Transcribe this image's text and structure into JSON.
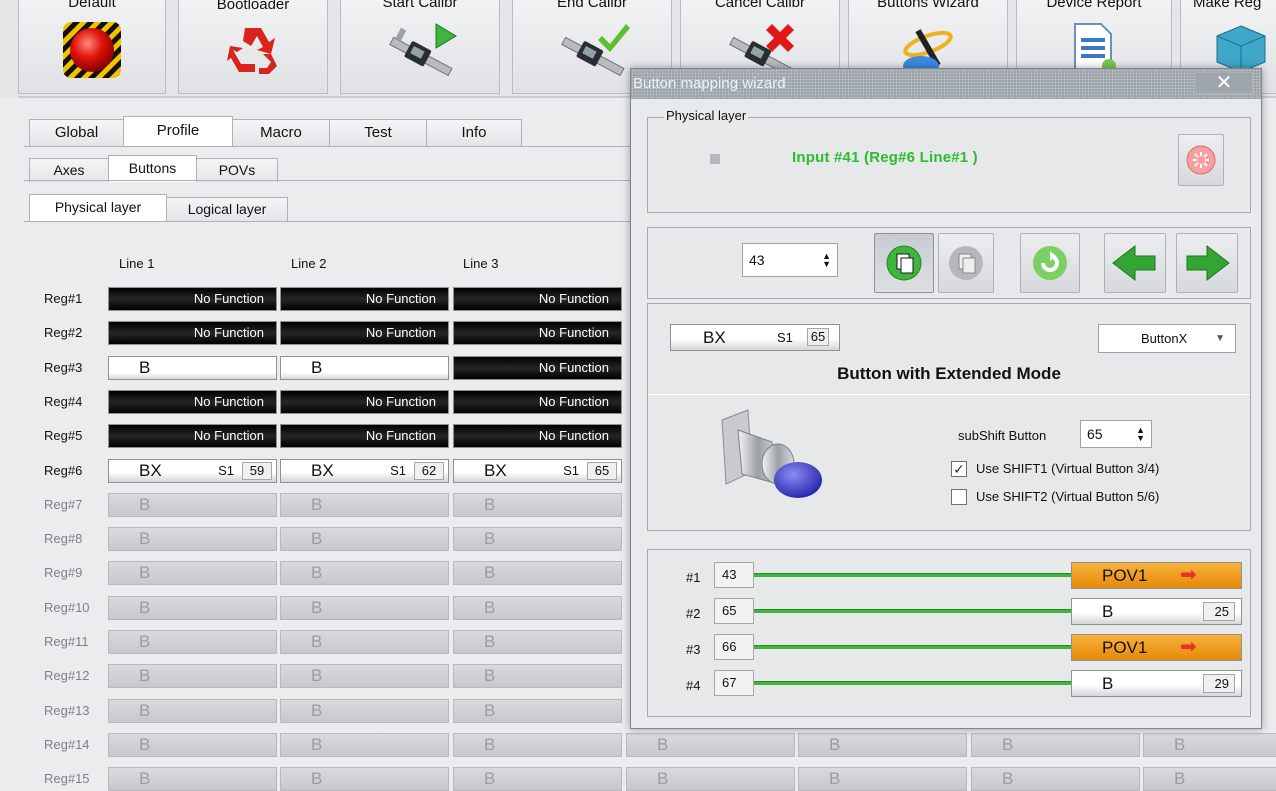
{
  "toolbar": {
    "buttons": [
      {
        "label": "Default",
        "icon": "red-alarm-button-icon"
      },
      {
        "label": "Bootloader",
        "icon": "recycle-icon"
      },
      {
        "label": "Start Calibr",
        "icon": "caliper-play-icon"
      },
      {
        "label": "End Calibr",
        "icon": "caliper-check-icon"
      },
      {
        "label": "Cancel Calibr",
        "icon": "caliper-cancel-icon"
      },
      {
        "label": "Buttons Wizard",
        "icon": "wizard-wand-icon"
      },
      {
        "label": "Device Report",
        "icon": "document-report-icon"
      },
      {
        "label": "Make Reg",
        "icon": "cube-registry-icon"
      }
    ]
  },
  "tabs": {
    "main": [
      "Global",
      "Profile",
      "Macro",
      "Test",
      "Info"
    ],
    "main_active": "Profile",
    "sub": [
      "Axes",
      "Buttons",
      "POVs"
    ],
    "sub_active": "Buttons",
    "layer": [
      "Physical layer",
      "Logical layer"
    ],
    "layer_active": "Physical layer"
  },
  "grid": {
    "columns": [
      "Line 1",
      "Line 2",
      "Line 3"
    ],
    "no_function_label": "No Function",
    "rows": [
      {
        "label": "Reg#1",
        "cells": [
          "No Function",
          "No Function",
          "No Function"
        ]
      },
      {
        "label": "Reg#2",
        "cells": [
          "No Function",
          "No Function",
          "No Function"
        ]
      },
      {
        "label": "Reg#3",
        "cells": [
          "B",
          "B",
          "No Function"
        ]
      },
      {
        "label": "Reg#4",
        "cells": [
          "No Function",
          "No Function",
          "No Function"
        ]
      },
      {
        "label": "Reg#5",
        "cells": [
          "No Function",
          "No Function",
          "No Function"
        ]
      },
      {
        "label": "Reg#6",
        "cells": [
          {
            "type": "BX",
            "shift": "S1",
            "num": "59"
          },
          {
            "type": "BX",
            "shift": "S1",
            "num": "62"
          },
          {
            "type": "BX",
            "shift": "S1",
            "num": "65"
          }
        ]
      },
      {
        "label": "Reg#7",
        "cells": [
          "B",
          "B",
          "B"
        ]
      },
      {
        "label": "Reg#8",
        "cells": [
          "B",
          "B",
          "B"
        ]
      },
      {
        "label": "Reg#9",
        "cells": [
          "B",
          "B",
          "B"
        ]
      },
      {
        "label": "Reg#10",
        "cells": [
          "B",
          "B",
          "B"
        ]
      },
      {
        "label": "Reg#11",
        "cells": [
          "B",
          "B",
          "B"
        ]
      },
      {
        "label": "Reg#12",
        "cells": [
          "B",
          "B",
          "B"
        ]
      },
      {
        "label": "Reg#13",
        "cells": [
          "B",
          "B",
          "B"
        ]
      },
      {
        "label": "Reg#14",
        "cells": [
          "B",
          "B",
          "B",
          "B",
          "B",
          "B",
          "B"
        ]
      },
      {
        "label": "Reg#15",
        "cells": [
          "B",
          "B",
          "B",
          "B",
          "B",
          "B",
          "B"
        ]
      }
    ]
  },
  "dialog": {
    "title": "Button mapping wizard",
    "close_label": "✕",
    "physical_layer": {
      "caption": "Physical layer",
      "input_label": "Input #41  (Reg#6  Line#1 )"
    },
    "spin_value": "43",
    "button_field": {
      "type": "BX",
      "shift": "S1",
      "num": "65"
    },
    "button_type_select": "ButtonX",
    "mode_title": "Button  with Extended Mode",
    "subshift": {
      "label": "subShift Button",
      "value": "65"
    },
    "shift1": {
      "label": "Use SHIFT1 (Virtual Button 3/4)",
      "checked": true
    },
    "shift2": {
      "label": "Use SHIFT2 (Virtual Button 5/6)",
      "checked": false
    },
    "mappings": [
      {
        "id": "#1",
        "input": "43",
        "output": "POV1",
        "kind": "pov",
        "num": ""
      },
      {
        "id": "#2",
        "input": "65",
        "output": "B",
        "kind": "b",
        "num": "25"
      },
      {
        "id": "#3",
        "input": "66",
        "output": "POV1",
        "kind": "pov",
        "num": ""
      },
      {
        "id": "#4",
        "input": "67",
        "output": "B",
        "kind": "b",
        "num": "29"
      }
    ],
    "colors": {
      "accent_green": "#2bbd2b",
      "pov_orange": "#f0a020",
      "arrow_red": "#e8332a"
    }
  }
}
